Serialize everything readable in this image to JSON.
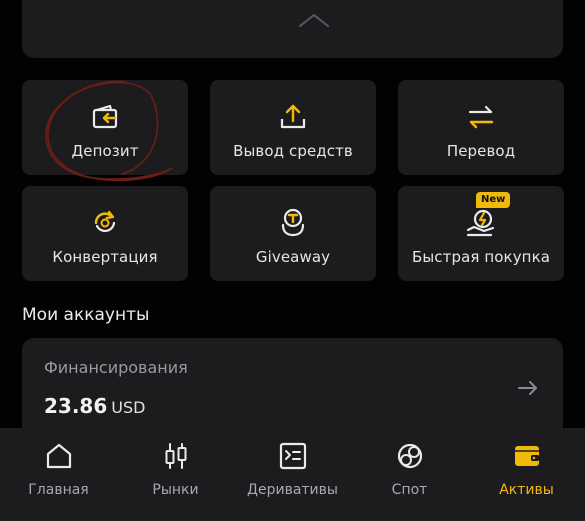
{
  "actions": [
    {
      "label": "Депозит",
      "icon": "deposit-wallet-icon"
    },
    {
      "label": "Вывод средств",
      "icon": "withdraw-upload-icon"
    },
    {
      "label": "Перевод",
      "icon": "transfer-arrows-icon"
    },
    {
      "label": "Конвертация",
      "icon": "convert-refresh-icon"
    },
    {
      "label": "Giveaway",
      "icon": "giveaway-hand-icon"
    },
    {
      "label": "Быстрая покупка",
      "icon": "quick-buy-icon",
      "badge": "New"
    }
  ],
  "accounts_section": {
    "title": "Мои аккаунты",
    "account": {
      "name": "Финансирования",
      "amount": "23.86",
      "currency": "USD"
    }
  },
  "bottom_nav": [
    {
      "label": "Главная",
      "icon": "home-icon",
      "active": false
    },
    {
      "label": "Рынки",
      "icon": "candlestick-icon",
      "active": false
    },
    {
      "label": "Деривативы",
      "icon": "derivatives-icon",
      "active": false
    },
    {
      "label": "Спот",
      "icon": "spot-icon",
      "active": false
    },
    {
      "label": "Активы",
      "icon": "wallet-icon",
      "active": true
    }
  ],
  "colors": {
    "accent": "#f0b90b",
    "card": "#1c1c1f",
    "background": "#020202",
    "annotation": "#7a1a12"
  }
}
